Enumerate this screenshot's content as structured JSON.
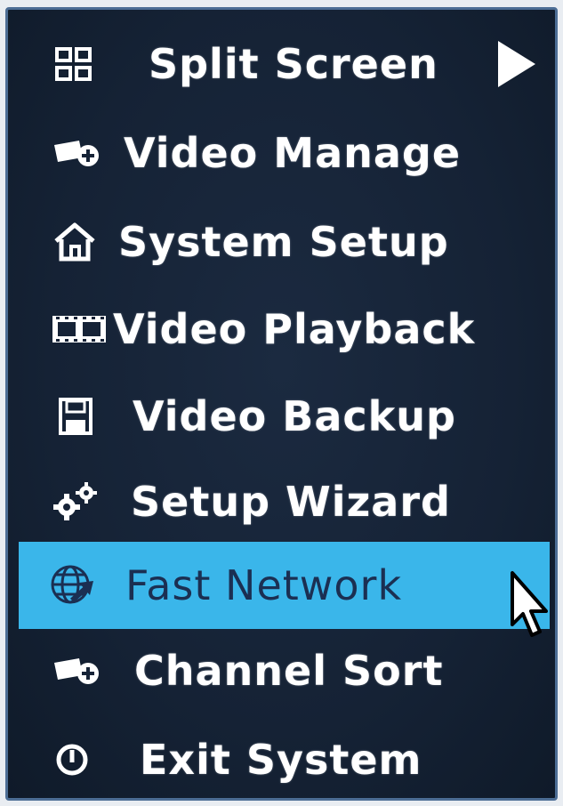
{
  "menu": {
    "items": [
      {
        "label": "Split Screen",
        "icon": "split-screen-icon",
        "has_submenu": true
      },
      {
        "label": "Video Manage",
        "icon": "camera-add-icon"
      },
      {
        "label": "System Setup",
        "icon": "home-icon"
      },
      {
        "label": "Video Playback",
        "icon": "filmstrip-icon"
      },
      {
        "label": "Video Backup",
        "icon": "floppy-disk-icon"
      },
      {
        "label": "Setup Wizard",
        "icon": "gears-icon"
      },
      {
        "label": "Fast Network",
        "icon": "globe-arrow-icon",
        "selected": true
      },
      {
        "label": "Channel Sort",
        "icon": "camera-add-icon"
      },
      {
        "label": "Exit System",
        "icon": "power-icon"
      }
    ],
    "colors": {
      "background": "#152235",
      "border": "#4c6d95",
      "text": "#ffffff",
      "highlight": "#3ab6ea",
      "highlight_text": "#1b2f52"
    }
  }
}
